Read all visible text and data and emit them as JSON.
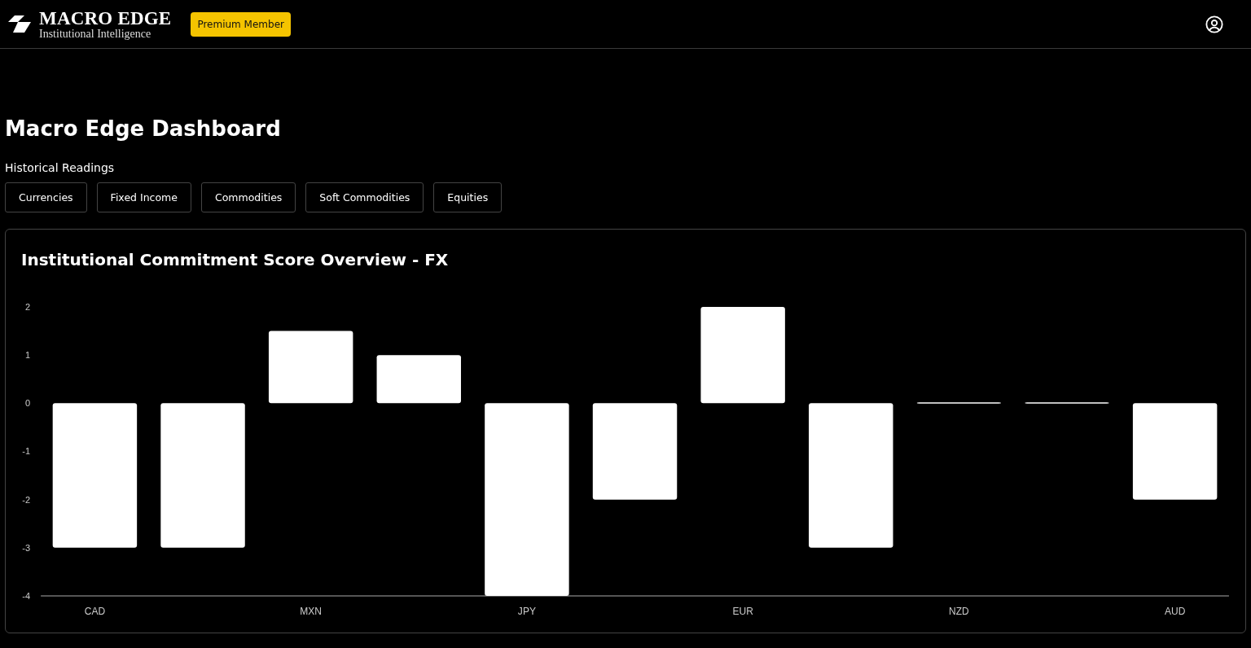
{
  "brand": {
    "name": "MACRO EDGE",
    "tagline": "Institutional Intelligence",
    "badge": "Premium Member"
  },
  "page": {
    "title": "Macro Edge Dashboard",
    "subtitle": "Historical Readings"
  },
  "tabs": [
    {
      "label": "Currencies"
    },
    {
      "label": "Fixed Income"
    },
    {
      "label": "Commodities"
    },
    {
      "label": "Soft Commodities"
    },
    {
      "label": "Equities"
    }
  ],
  "card": {
    "title": "Institutional Commitment Score Overview - FX",
    "chart_data": {
      "type": "bar",
      "categories": [
        "CAD",
        null,
        "MXN",
        null,
        "JPY",
        null,
        "EUR",
        null,
        "NZD",
        null,
        "AUD"
      ],
      "values": [
        -3,
        -3,
        1.5,
        1,
        -4,
        -2,
        2,
        -3,
        0,
        0,
        -2
      ],
      "ylim": [
        -4,
        2
      ],
      "yticks": [
        -4,
        -3,
        -2,
        -1,
        0,
        1,
        2
      ]
    }
  }
}
